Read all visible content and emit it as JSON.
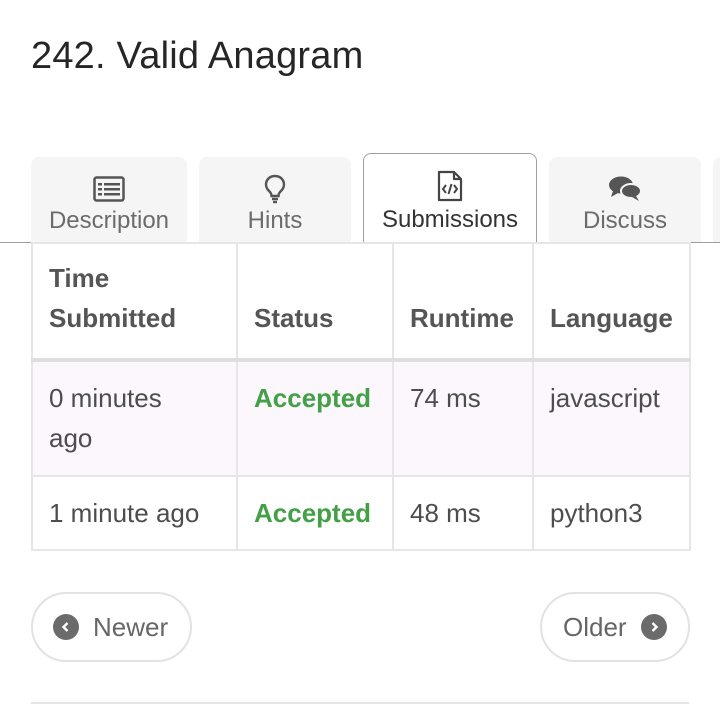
{
  "problem": {
    "title": "242. Valid Anagram"
  },
  "tabs": [
    {
      "label": "Description",
      "icon": "list-icon",
      "active": false
    },
    {
      "label": "Hints",
      "icon": "lightbulb-icon",
      "active": false
    },
    {
      "label": "Submissions",
      "icon": "code-file-icon",
      "active": true
    },
    {
      "label": "Discuss",
      "icon": "chat-bubbles-icon",
      "active": false
    }
  ],
  "table": {
    "headers": [
      "Time Submitted",
      "Status",
      "Runtime",
      "Language"
    ],
    "rows": [
      {
        "time": "0 minutes ago",
        "status": "Accepted",
        "runtime": "74 ms",
        "language": "javascript"
      },
      {
        "time": "1 minute ago",
        "status": "Accepted",
        "runtime": "48 ms",
        "language": "python3"
      }
    ]
  },
  "pager": {
    "newer": "Newer",
    "older": "Older"
  },
  "colors": {
    "accepted": "#43a047",
    "tab_bg": "#f5f5f5",
    "border": "#e6e6e6"
  }
}
